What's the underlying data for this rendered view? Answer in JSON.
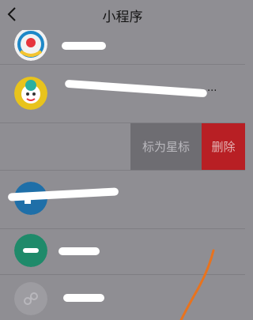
{
  "header": {
    "title": "小程序",
    "back_icon": "chevron-left-icon"
  },
  "list": {
    "items": [
      {
        "label": "",
        "avatar_icon": "mascot-blue-icon",
        "colors": [
          "#1e88c8",
          "#e6343c",
          "#f4c430"
        ]
      },
      {
        "label": "...",
        "avatar_icon": "chef-mascot-icon",
        "colors": [
          "#e8c31c",
          "#2ab0a0"
        ]
      },
      {
        "label": "",
        "avatar_icon": "blue-circle-icon",
        "colors": [
          "#1f6fa8"
        ]
      },
      {
        "label": "",
        "avatar_icon": "green-circle-icon",
        "colors": [
          "#1f8a6a"
        ]
      },
      {
        "label": "",
        "avatar_icon": "mini-program-icon",
        "colors": [
          "#9d9ca1"
        ]
      }
    ]
  },
  "swipe_actions": {
    "star_label": "标为星标",
    "delete_label": "删除"
  },
  "accent": {
    "delete": "#b81f24",
    "star": "#6e6d72",
    "annotation": "#e8731e"
  }
}
